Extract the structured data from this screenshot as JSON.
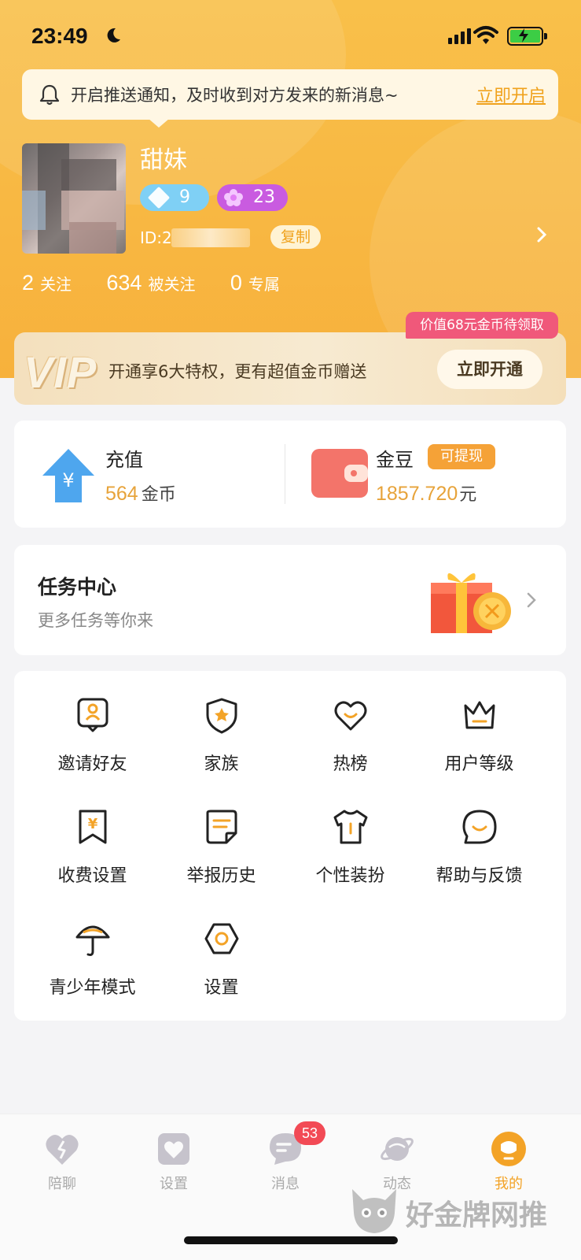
{
  "status_bar": {
    "time": "23:49"
  },
  "notification": {
    "text": "开启推送通知，及时收到对方发来的新消息~",
    "action": "立即开启"
  },
  "profile": {
    "name": "甜妹",
    "diamond_level": "9",
    "flower_level": "23",
    "id_prefix": "ID:2",
    "copy_label": "复制"
  },
  "stats": [
    {
      "num": "2",
      "label": "关注"
    },
    {
      "num": "634",
      "label": "被关注"
    },
    {
      "num": "0",
      "label": "专属"
    }
  ],
  "vip": {
    "logo": "VIP",
    "tag": "价值68元金币待领取",
    "desc": "开通享6大特权，更有超值金币赠送",
    "button": "立即开通"
  },
  "wallet": {
    "recharge_title": "充值",
    "coins_value": "564",
    "coins_unit": "金币",
    "beans_title": "金豆",
    "withdraw_tag": "可提现",
    "beans_value": "1857.720",
    "beans_unit": "元"
  },
  "task_center": {
    "title": "任务中心",
    "subtitle": "更多任务等你来"
  },
  "menu": [
    {
      "label": "邀请好友",
      "icon": "invite-icon"
    },
    {
      "label": "家族",
      "icon": "family-shield-icon"
    },
    {
      "label": "热榜",
      "icon": "heart-icon"
    },
    {
      "label": "用户等级",
      "icon": "crown-icon"
    },
    {
      "label": "收费设置",
      "icon": "yen-bookmark-icon"
    },
    {
      "label": "举报历史",
      "icon": "report-document-icon"
    },
    {
      "label": "个性装扮",
      "icon": "tshirt-icon"
    },
    {
      "label": "帮助与反馈",
      "icon": "chat-smile-icon"
    },
    {
      "label": "青少年模式",
      "icon": "umbrella-icon"
    },
    {
      "label": "设置",
      "icon": "hex-settings-icon"
    }
  ],
  "tabs": [
    {
      "label": "陪聊",
      "icon": "broken-heart-icon"
    },
    {
      "label": "设置",
      "icon": "heart-square-icon"
    },
    {
      "label": "消息",
      "icon": "message-icon"
    },
    {
      "label": "动态",
      "icon": "planet-icon"
    },
    {
      "label": "我的",
      "icon": "me-icon"
    }
  ],
  "message_badge": "53",
  "watermark": "好金牌网推",
  "colors": {
    "header": "#f7b13c",
    "accent": "#f3a327",
    "vip_tag": "#f0587a",
    "badge": "#f24a55"
  }
}
